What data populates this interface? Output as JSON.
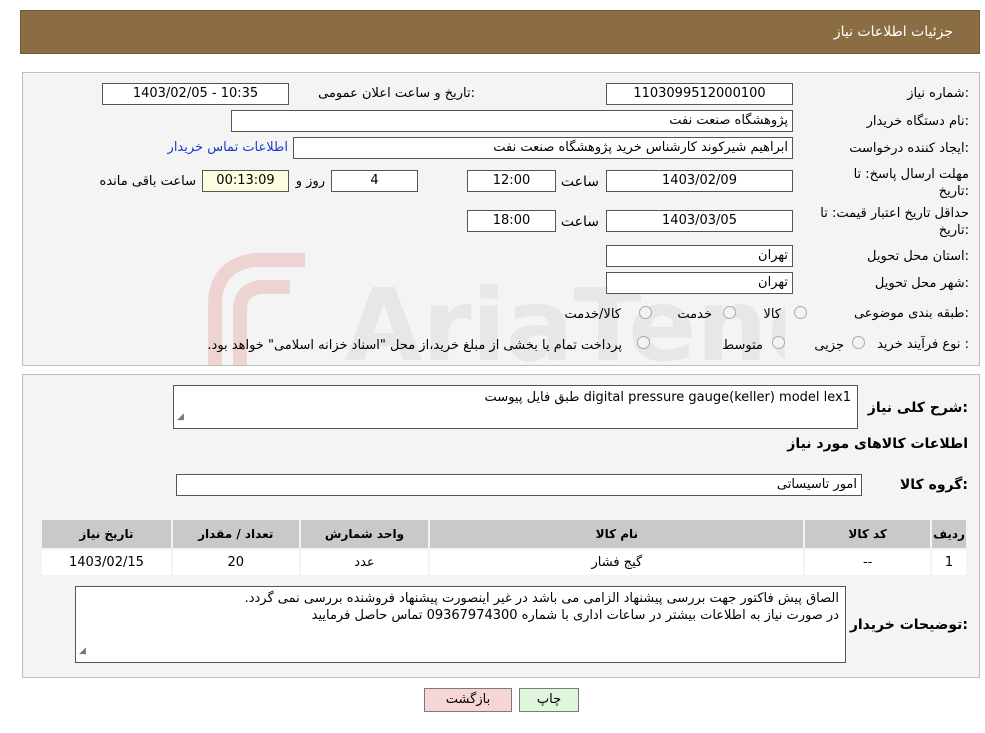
{
  "header": {
    "title": "جزئیات اطلاعات نیاز"
  },
  "form": {
    "need_number_label": "شماره نیاز:",
    "need_number": "1103099512000100",
    "announce_label": "تاریخ و ساعت اعلان عمومی:",
    "announce_value": "1403/02/05 - 10:35",
    "buyer_org_label": "نام دستگاه خریدار:",
    "buyer_org": "پژوهشگاه صنعت نفت",
    "creator_label": "ایجاد کننده درخواست:",
    "creator": "ابراهیم شیرکوند کارشناس خرید پژوهشگاه صنعت نفت",
    "contact_link": "اطلاعات تماس خریدار",
    "deadline_label_1": "مهلت ارسال پاسخ: تا",
    "deadline_label_2": "تاریخ:",
    "deadline_date": "1403/02/09",
    "time_label": "ساعت",
    "deadline_time": "12:00",
    "days_value": "4",
    "days_label": "روز و",
    "remaining_time": "00:13:09",
    "remaining_label": "ساعت باقی مانده",
    "validity_label_1": "حداقل تاریخ اعتبار قیمت: تا",
    "validity_label_2": "تاریخ:",
    "validity_date": "1403/03/05",
    "validity_time_label": "ساعت",
    "validity_time": "18:00",
    "province_label": "استان محل تحویل:",
    "province": "تهران",
    "city_label": "شهر محل تحویل:",
    "city": "تهران",
    "category_label": "طبقه بندی موضوعی:",
    "category_options": [
      "کالا",
      "خدمت",
      "کالا/خدمت"
    ],
    "process_label": "نوع فرآیند خرید :",
    "process_options": [
      "جزیی",
      "متوسط"
    ],
    "process_note": "پرداخت تمام یا بخشی از مبلغ خرید،از محل \"اسناد خزانه اسلامی\" خواهد بود."
  },
  "details": {
    "summary_label": "شرح کلی نیاز:",
    "summary": "digital pressure gauge(keller) model lex1 طبق فایل پیوست",
    "items_title": "اطلاعات کالاهای مورد نیاز",
    "group_label": "گروه کالا:",
    "group": "امور تاسیساتی",
    "columns": [
      "ردیف",
      "کد کالا",
      "نام کالا",
      "واحد شمارش",
      "تعداد / مقدار",
      "تاریخ نیاز"
    ],
    "rows": [
      [
        "1",
        "--",
        "گیج فشار",
        "عدد",
        "20",
        "1403/02/15"
      ]
    ],
    "buyer_notes_label": "توضیحات خریدار:",
    "buyer_notes_1": "الصاق پیش فاکتور جهت بررسی پیشنهاد الزامی می باشد در غیر اینصورت پیشنهاد فروشنده بررسی نمی گردد.",
    "buyer_notes_2": "در صورت نیاز به اطلاعات بیشتر در ساعات اداری با شماره 09367974300 تماس حاصل فرمایید"
  },
  "buttons": {
    "print": "چاپ",
    "back": "بازگشت"
  },
  "watermark": {
    "text": "AriaTender.neT"
  },
  "colors": {
    "header": "#8b6d43",
    "back_button": "#f6d5d5",
    "print_button": "#dff5dc",
    "link": "#1a3ccc"
  }
}
